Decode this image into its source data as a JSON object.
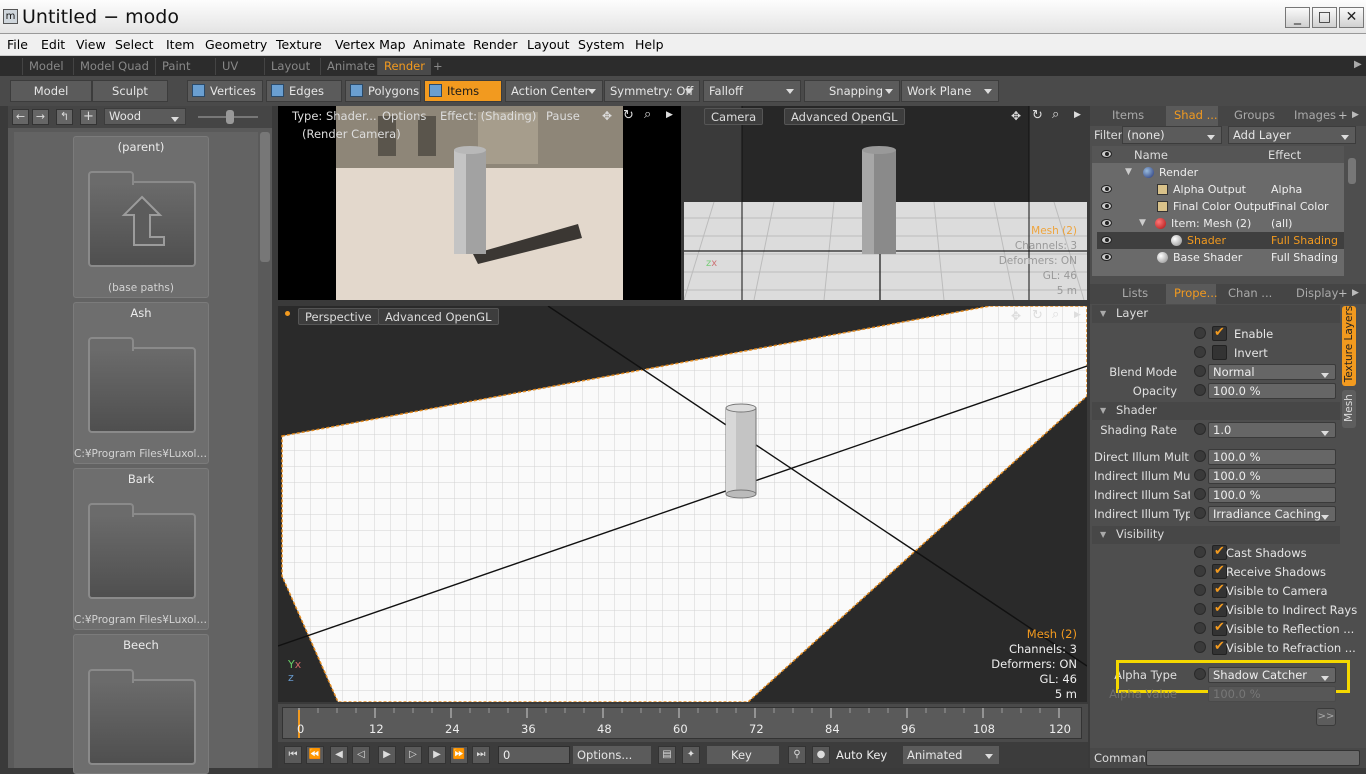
{
  "window": {
    "title": "Untitled − modo",
    "app_icon": "modo-icon",
    "controls": [
      "_",
      "□",
      "✕"
    ]
  },
  "menu": [
    "File",
    "Edit",
    "View",
    "Select",
    "Item",
    "Geometry",
    "Texture",
    "Vertex Map",
    "Animate",
    "Render",
    "Layout",
    "System",
    "Help"
  ],
  "layout_tabs": [
    "Model",
    "Model Quad",
    "Paint",
    "UV",
    "Layout",
    "Animate",
    "Render",
    "+"
  ],
  "active_layout": "Render",
  "toolbar": {
    "model": "Model",
    "sculpt": "Sculpt",
    "vertices": "Vertices",
    "edges": "Edges",
    "polygons": "Polygons",
    "items": "Items",
    "action_center": "Action Center",
    "symmetry": "Symmetry: Off",
    "falloff": "Falloff",
    "snapping": "Snapping",
    "work_plane": "Work Plane"
  },
  "preset_browser": {
    "filter": "Wood",
    "cards": [
      {
        "name": "(parent)",
        "path": "(base paths)"
      },
      {
        "name": "Ash",
        "path": "C:¥Program Files¥Luxolo..."
      },
      {
        "name": "Bark",
        "path": "C:¥Program Files¥Luxolo..."
      },
      {
        "name": "Beech",
        "path": ""
      }
    ]
  },
  "render_preview": {
    "type": "Type: Shader...",
    "options": "Options",
    "effect": "Effect: (Shading)",
    "pause": "Pause",
    "camera": "(Render Camera)"
  },
  "camera_view": {
    "name": "Camera",
    "mode": "Advanced OpenGL",
    "overlay": [
      "Mesh (2)",
      "Channels: 3",
      "Deformers: ON",
      "GL: 46",
      "5 m"
    ]
  },
  "perspective_view": {
    "name": "Perspective",
    "mode": "Advanced OpenGL",
    "overlay": [
      "Mesh (2)",
      "Channels: 3",
      "Deformers: ON",
      "GL: 46",
      "5 m"
    ]
  },
  "shader_tree": {
    "tabs": [
      "Items",
      "Shad ...",
      "Groups",
      "Images"
    ],
    "filter_label": "Filter",
    "filter_value": "(none)",
    "add_layer": "Add Layer",
    "col_name": "Name",
    "col_effect": "Effect",
    "rows": [
      {
        "name": "Render",
        "effect": ""
      },
      {
        "name": "Alpha Output",
        "effect": "Alpha"
      },
      {
        "name": "Final Color Output",
        "effect": "Final Color"
      },
      {
        "name": "Item: Mesh (2)",
        "effect": "(all)"
      },
      {
        "name": "Shader",
        "effect": "Full Shading"
      },
      {
        "name": "Base Shader",
        "effect": "Full Shading"
      }
    ]
  },
  "properties": {
    "tabs": [
      "Lists",
      "Prope...",
      "Chan ...",
      "Display",
      "+"
    ],
    "side_tabs": [
      "Texture Layers",
      "Mesh"
    ],
    "layer_section": "Layer",
    "enable": "Enable",
    "invert": "Invert",
    "blend_mode_label": "Blend Mode",
    "blend_mode": "Normal",
    "opacity_label": "Opacity",
    "opacity": "100.0 %",
    "shader_section": "Shader",
    "shading_rate_label": "Shading Rate",
    "shading_rate": "1.0",
    "direct_label": "Direct Illum Multi ...",
    "direct": "100.0 %",
    "indirect_label": "Indirect Illum Mul...",
    "indirect": "100.0 %",
    "indirect_sat_label": "Indirect Illum Sat...",
    "indirect_sat": "100.0 %",
    "indirect_type_label": "Indirect Illum Type",
    "indirect_type": "Irradiance Caching",
    "visibility_section": "Visibility",
    "checks": [
      "Cast Shadows",
      "Receive Shadows",
      "Visible to Camera",
      "Visible to Indirect Rays",
      "Visible to Reflection ...",
      "Visible to Refraction ..."
    ],
    "alpha_type_label": "Alpha Type",
    "alpha_type": "Shadow Catcher",
    "alpha_value_label": "Alpha Value",
    "alpha_value": "100.0 %",
    "more": ">>"
  },
  "timeline": {
    "ticks": [
      "0",
      "12",
      "24",
      "36",
      "48",
      "60",
      "72",
      "84",
      "96",
      "108",
      "120"
    ]
  },
  "transport": {
    "frame": "0",
    "options": "Options...",
    "key": "Key",
    "auto_key": "Auto Key",
    "mode": "Animated"
  },
  "command": {
    "label": "Command",
    "value": ""
  },
  "colors": {
    "accent": "#f29a1f",
    "highlight_box": "#f5d800"
  }
}
